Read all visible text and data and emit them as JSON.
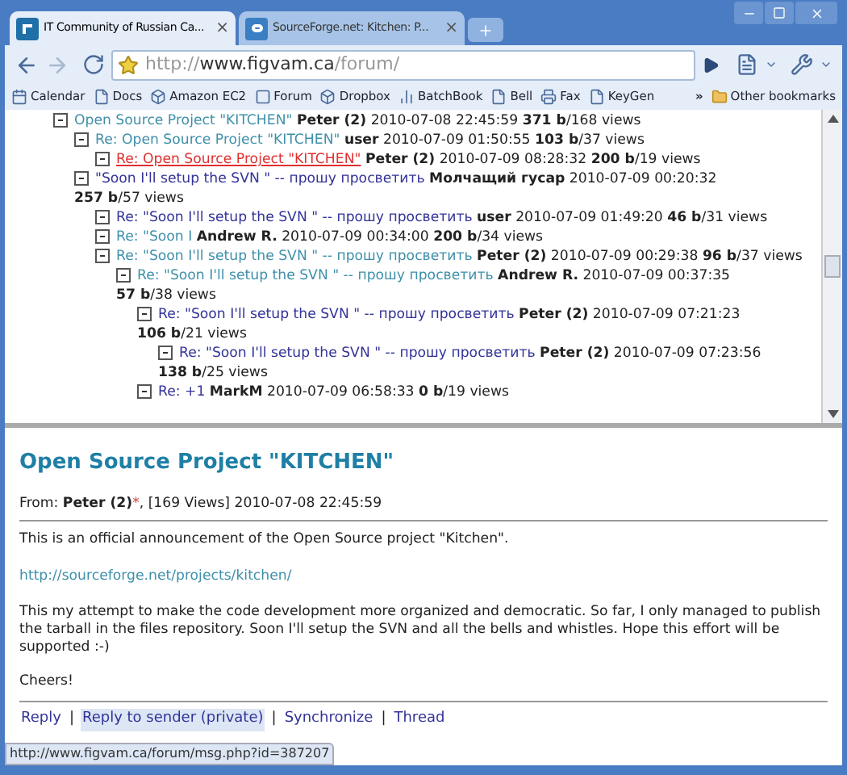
{
  "tabs": [
    {
      "title": "IT Community of Russian Ca...",
      "close": "×",
      "selected": true
    },
    {
      "title": "SourceForge.net: Kitchen: P...",
      "close": "×",
      "selected": false
    }
  ],
  "toolbar": {
    "url_scheme": "http://",
    "url_host": "www.figvam.ca",
    "url_path": "/forum/"
  },
  "bookmarks": [
    {
      "label": "Calendar"
    },
    {
      "label": "Docs"
    },
    {
      "label": "Amazon EC2"
    },
    {
      "label": "Forum"
    },
    {
      "label": "Dropbox"
    },
    {
      "label": "BatchBook"
    },
    {
      "label": "Bell"
    },
    {
      "label": "Fax"
    },
    {
      "label": "KeyGen"
    }
  ],
  "bookmarks_overflow": "»",
  "other_bookmarks": "Other bookmarks",
  "thread": [
    {
      "title": "Open Source Project \"KITCHEN\"",
      "author": "Peter (2)",
      "date": "2010-07-08 22:45:59",
      "size": "371 b",
      "views": "/168 views",
      "selected": false,
      "visited": true,
      "children": [
        {
          "title": "Re: Open Source Project \"KITCHEN\"",
          "author": "user",
          "date": "2010-07-09 01:50:55",
          "size": "103 b",
          "views": "/37 views",
          "selected": false,
          "visited": true,
          "children": [
            {
              "title": "Re: Open Source Project \"KITCHEN\"",
              "author": "Peter (2)",
              "date": "2010-07-09 08:28:32",
              "size": "200 b",
              "views": "/19 views",
              "selected": true,
              "visited": true
            }
          ]
        },
        {
          "title": "\"Soon I'll setup the SVN \" -- прошу просветить",
          "author": "Молчащий гусар",
          "date": "2010-07-09 00:20:32",
          "size": "257 b",
          "views": "/57 views",
          "selected": false,
          "visited": false,
          "children": [
            {
              "title": "Re: \"Soon I'll setup the SVN \" -- прошу просветить",
              "author": "user",
              "date": "2010-07-09 01:49:20",
              "size": "46 b",
              "views": "/31 views",
              "selected": false,
              "visited": false
            },
            {
              "title": "Re: \"Soon I",
              "author": "Andrew R.",
              "date": "2010-07-09 00:34:00",
              "size": "200 b",
              "views": "/34 views",
              "selected": false,
              "visited": true
            },
            {
              "title": "Re: \"Soon I'll setup the SVN \" -- прошу просветить",
              "author": "Peter (2)",
              "date": "2010-07-09 00:29:38",
              "size": "96 b",
              "views": "/37 views",
              "selected": false,
              "visited": true,
              "children": [
                {
                  "title": "Re: \"Soon I'll setup the SVN \" -- прошу просветить",
                  "author": "Andrew R.",
                  "date": "2010-07-09 00:37:35",
                  "size": "57 b",
                  "views": "/38 views",
                  "selected": false,
                  "visited": true,
                  "children": [
                    {
                      "title": "Re: \"Soon I'll setup the SVN \" -- прошу просветить",
                      "author": "Peter (2)",
                      "date": "2010-07-09 07:21:23",
                      "size": "106 b",
                      "views": "/21 views",
                      "selected": false,
                      "visited": false,
                      "children": [
                        {
                          "title": "Re: \"Soon I'll setup the SVN \" -- прошу просветить",
                          "author": "Peter (2)",
                          "date": "2010-07-09 07:23:56",
                          "size": "138 b",
                          "views": "/25 views",
                          "selected": false,
                          "visited": false
                        }
                      ]
                    },
                    {
                      "title": "Re: +1",
                      "author": "MarkM",
                      "date": "2010-07-09 06:58:33",
                      "size": "0 b",
                      "views": "/19 views",
                      "selected": false,
                      "visited": false
                    }
                  ]
                }
              ]
            }
          ]
        }
      ]
    }
  ],
  "message": {
    "title": "Open Source Project \"KITCHEN\"",
    "from_label": "From:",
    "author": "Peter (2)",
    "author_mark": "*",
    "info": ", [169 Views] 2010-07-08 22:45:59",
    "paragraphs": [
      "This is an official announcement of the Open Source project \"Kitchen\"."
    ],
    "link": "http://sourceforge.net/projects/kitchen/",
    "paragraphs_after": [
      "This my attempt to make the code development more organized and democratic. So far, I only managed to publish the tarball in the files repository. Soon I'll setup the SVN and all the bells and whistles. Hope this effort will be supported :-)",
      "Cheers!"
    ],
    "actions": [
      {
        "label": "Reply",
        "hovered": false
      },
      {
        "label": "Reply to sender (private)",
        "hovered": true
      },
      {
        "label": "Synchronize",
        "hovered": false
      },
      {
        "label": "Thread",
        "hovered": false
      }
    ],
    "separator": "|"
  },
  "status_url": "http://www.figvam.ca/forum/msg.php?id=387207"
}
